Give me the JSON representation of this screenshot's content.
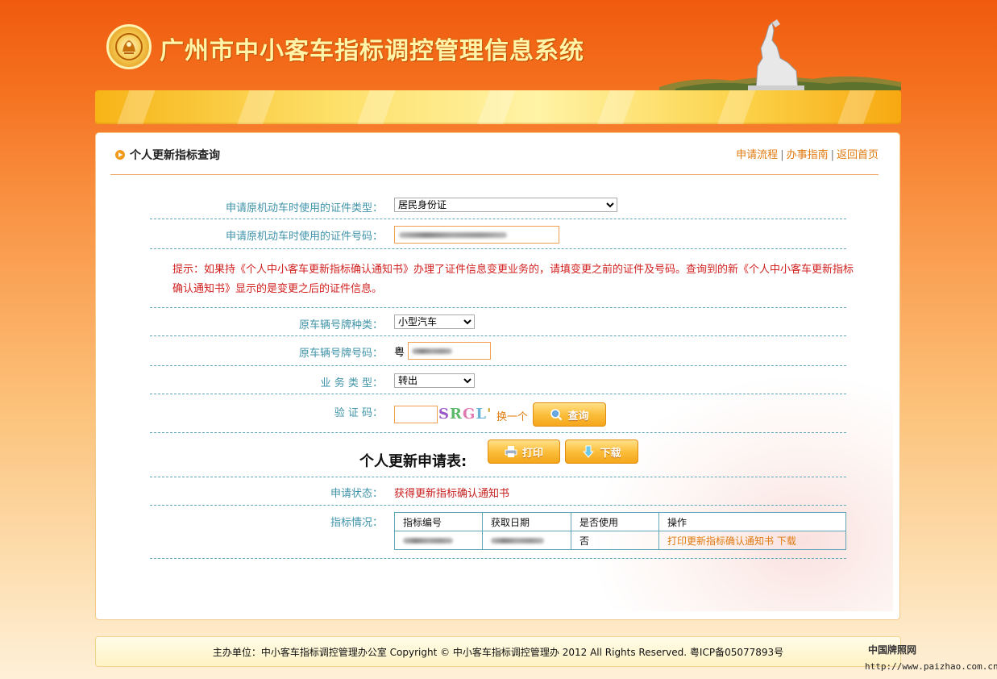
{
  "header": {
    "system_title": "广州市中小客车指标调控管理信息系统"
  },
  "panel": {
    "title": "个人更新指标查询",
    "links": [
      "申请流程",
      "办事指南",
      "返回首页"
    ],
    "link_separator": "|"
  },
  "form": {
    "id_type_label": "申请原机动车时使用的证件类型：",
    "id_type_value": "居民身份证",
    "id_number_label": "申请原机动车时使用的证件号码：",
    "tip": "提示：如果持《个人中小客车更新指标确认通知书》办理了证件信息变更业务的，请填变更之前的证件及号码。查询到的新《个人中小客车更新指标确认通知书》显示的是变更之后的证件信息。",
    "plate_type_label": "原车辆号牌种类：",
    "plate_type_value": "小型汽车",
    "plate_number_label": "原车辆号牌号码：",
    "plate_prefix": "粤",
    "business_type_label": "业 务 类 型：",
    "business_type_value": "转出",
    "captcha_label": "验 证 码：",
    "captcha_chars": [
      "S",
      "R",
      "G",
      "L",
      "'"
    ],
    "refresh_label": "换一个",
    "query_button": "查询"
  },
  "result": {
    "form_title": "个人更新申请表:",
    "print_button": "打印",
    "download_button": "下载",
    "status_label": "申请状态：",
    "status_value": "获得更新指标确认通知书",
    "quota_label": "指标情况：",
    "table": {
      "headers": [
        "指标编号",
        "获取日期",
        "是否使用",
        "操作"
      ],
      "row": {
        "used": "否",
        "action_print": "打印更新指标确认通知书",
        "action_download": "下载"
      }
    }
  },
  "footer": {
    "text": "主办单位：中小客车指标调控管理办公室  Copyright  ©  中小客车指标调控管理办   2012  All Rights Reserved.  粤ICP备05077893号"
  },
  "watermark": {
    "site_name": "中国牌照网",
    "site_url": "http://www.paizhao.com.cn"
  },
  "colors": {
    "accent_orange": "#e07a10",
    "label_teal": "#3f93a8",
    "alert_red": "#d21f1f"
  }
}
